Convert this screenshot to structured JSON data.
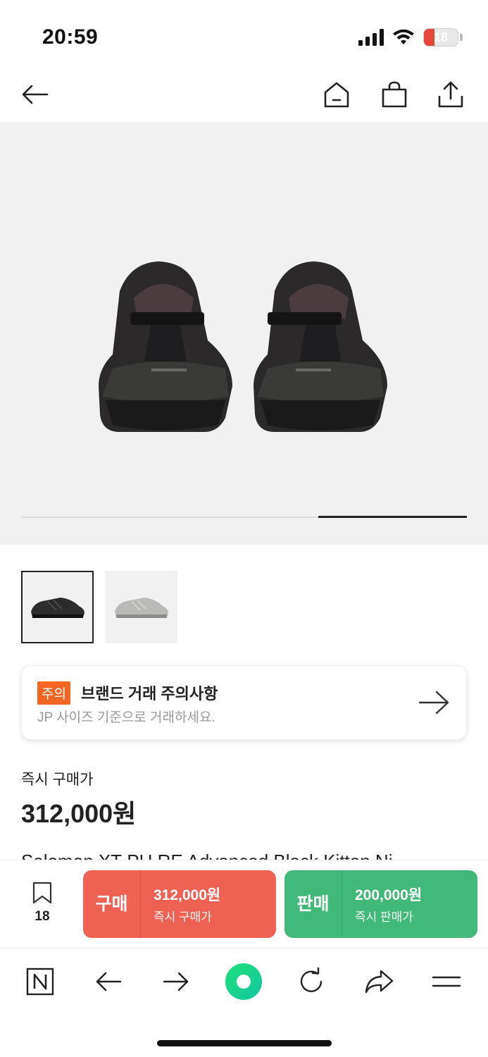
{
  "status_bar": {
    "time": "20:59",
    "battery_level": "18"
  },
  "header": {
    "back_icon": "arrow-left-icon",
    "home_icon": "home-icon",
    "cart_icon": "shopping-bag-icon",
    "share_icon": "share-icon"
  },
  "gallery": {
    "total_pages": 3,
    "current_page": 3
  },
  "thumbnails": [
    {
      "name": "black-colorway",
      "selected": true
    },
    {
      "name": "grey-colorway",
      "selected": false
    }
  ],
  "notice": {
    "badge": "주의",
    "title": "브랜드 거래 주의사항",
    "description": "JP 사이즈 기준으로 거래하세요."
  },
  "price": {
    "label": "즉시 구매가",
    "value": "312,000원"
  },
  "product": {
    "name": "Salomon XT-PU.RE Advanced Black Kitten Ni"
  },
  "action_bar": {
    "wish_count": "18",
    "buy": {
      "kind": "구매",
      "price": "312,000원",
      "sub": "즉시 구매가",
      "color": "#ef6253"
    },
    "sell": {
      "kind": "판매",
      "price": "200,000원",
      "sub": "즉시 판매가",
      "color": "#41b979"
    }
  },
  "browser_toolbar": {
    "items": [
      "naver-icon",
      "back-arrow-icon",
      "forward-arrow-icon",
      "green-dot-icon",
      "refresh-icon",
      "share-arrow-icon",
      "menu-icon"
    ],
    "accent": "#19ce60"
  }
}
